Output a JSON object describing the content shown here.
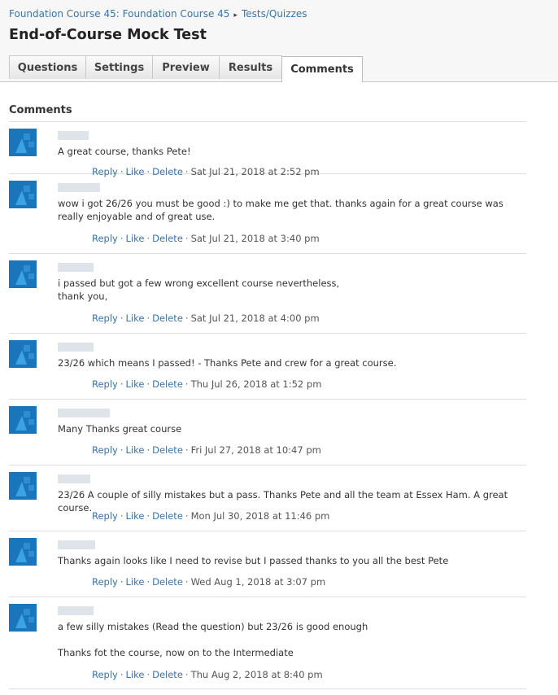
{
  "breadcrumb": {
    "course": "Foundation Course 45: Foundation Course 45",
    "separator": "▸",
    "section": "Tests/Quizzes"
  },
  "page_title": "End-of-Course Mock Test",
  "tabs": [
    {
      "label": "Questions",
      "active": false
    },
    {
      "label": "Settings",
      "active": false
    },
    {
      "label": "Preview",
      "active": false
    },
    {
      "label": "Results",
      "active": false
    },
    {
      "label": "Comments",
      "active": true
    }
  ],
  "comments_section": {
    "title": "Comments",
    "action_labels": {
      "reply": "Reply",
      "like": "Like",
      "delete": "Delete",
      "separator": "·"
    },
    "items": [
      {
        "text": "A great course, thanks Pete!",
        "timestamp": "Sat Jul 21, 2018 at 2:52 pm"
      },
      {
        "text": "wow i got 26/26 you must be good :) to make me get that. thanks again for a great course was really enjoyable and of great use.",
        "timestamp": "Sat Jul 21, 2018 at 3:40 pm"
      },
      {
        "text": "i passed but got a few wrong excellent course nevertheless,\nthank you,",
        "timestamp": "Sat Jul 21, 2018 at 4:00 pm"
      },
      {
        "text": "23/26 which means I passed! - Thanks Pete and crew for a great course.",
        "timestamp": "Thu Jul 26, 2018 at 1:52 pm"
      },
      {
        "text": "Many Thanks great course",
        "timestamp": "Fri Jul 27, 2018 at 10:47 pm"
      },
      {
        "text": "23/26 A couple of silly mistakes but a pass. Thanks Pete and all the team at Essex Ham. A great course.",
        "timestamp": "Mon Jul 30, 2018 at 11:46 pm"
      },
      {
        "text": "Thanks again looks like I need to revise but I passed thanks to you all the best Pete",
        "timestamp": "Wed Aug 1, 2018 at 3:07 pm"
      },
      {
        "text": "a few silly mistakes (Read the question) but 23/26 is good enough\n\nThanks fot the course, now on to the Intermediate",
        "timestamp": "Thu Aug 2, 2018 at 8:40 pm"
      }
    ]
  },
  "colors": {
    "link": "#3a74a8",
    "avatar_bg": "#1b75bb",
    "avatar_shape": "#3ba3e0"
  }
}
